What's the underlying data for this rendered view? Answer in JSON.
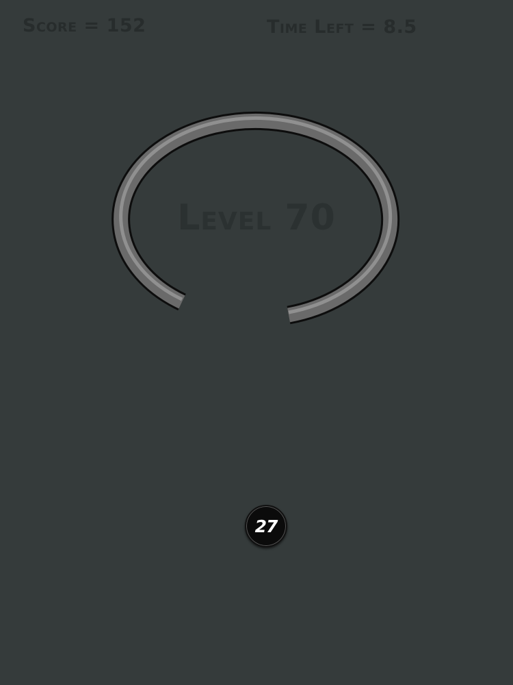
{
  "colors": {
    "background": "#353b3b",
    "hud_text": "#272c2c",
    "level_text": "#2b3131",
    "ring_fill": "#6a6a6a",
    "ring_highlight": "#9a9a9a",
    "ring_outline": "#0d0d0d",
    "ball": "#0b0b0b",
    "ball_number": "#ffffff"
  },
  "hud": {
    "score_text": "Score = 152",
    "time_text": "Time Left = 8.5"
  },
  "level": {
    "label": "Level 70"
  },
  "ball": {
    "number": "27"
  }
}
